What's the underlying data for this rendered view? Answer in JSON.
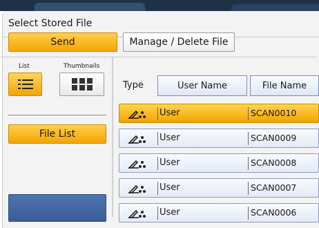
{
  "window": {
    "title": "Select Stored File"
  },
  "toolbar": {
    "send_label": "Send",
    "manage_label": "Manage / Delete File"
  },
  "view": {
    "list_label": "List",
    "thumbnails_label": "Thumbnails",
    "selected": "list"
  },
  "sidebar": {
    "file_list_label": "File List"
  },
  "table": {
    "type_label": "Type",
    "columns": [
      "User Name",
      "File Name"
    ],
    "rows": [
      {
        "type_icon": "scan-shared-icon",
        "user": "User",
        "file": "SCAN0010",
        "selected": true
      },
      {
        "type_icon": "scan-shared-icon",
        "user": "User",
        "file": "SCAN0009",
        "selected": false
      },
      {
        "type_icon": "scan-shared-icon",
        "user": "User",
        "file": "SCAN0008",
        "selected": false
      },
      {
        "type_icon": "scan-shared-icon",
        "user": "User",
        "file": "SCAN0007",
        "selected": false
      },
      {
        "type_icon": "scan-shared-icon",
        "user": "User",
        "file": "SCAN0006",
        "selected": false
      }
    ]
  },
  "colors": {
    "accent": "#f5a500",
    "header_bg": "#1f3147",
    "row_bg": "#e9eef8",
    "blue_button": "#4466a4"
  }
}
